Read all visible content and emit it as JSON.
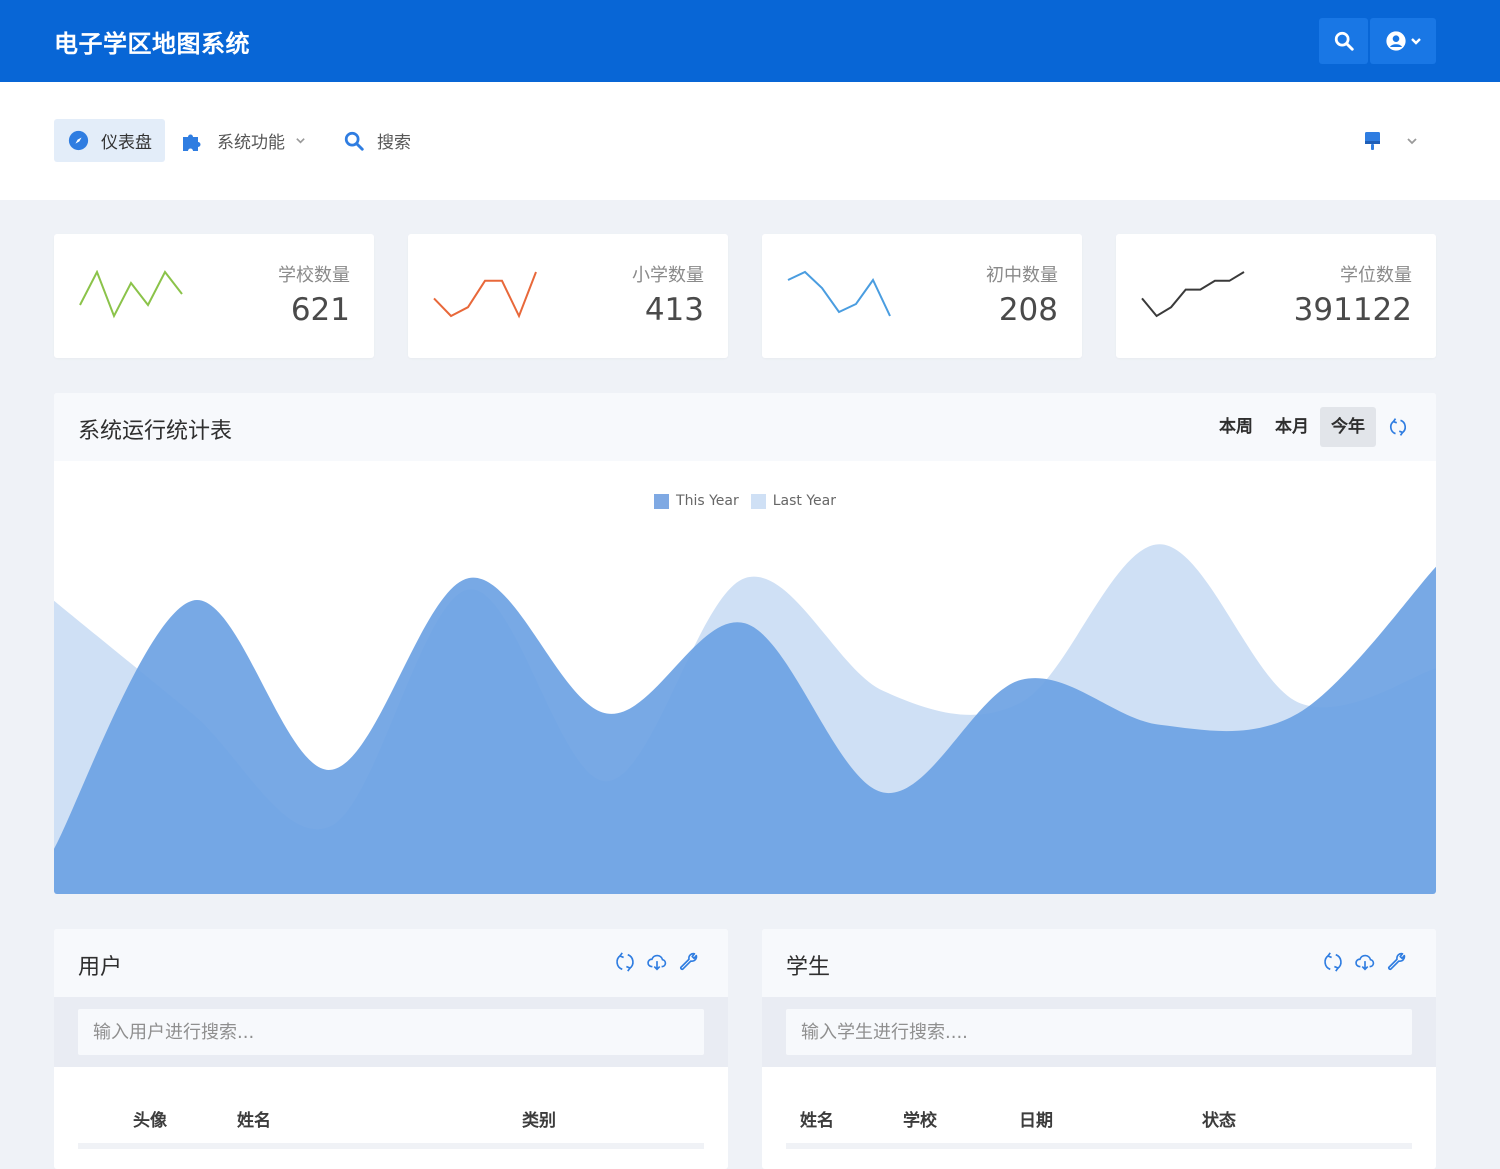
{
  "app": {
    "title": "电子学区地图系统"
  },
  "nav": {
    "dashboard": "仪表盘",
    "functions": "系统功能",
    "search": "搜索"
  },
  "stats": [
    {
      "label": "学校数量",
      "value": "621",
      "color": "#8bc34a",
      "trend": [
        3,
        6,
        2,
        5,
        3,
        6,
        4
      ]
    },
    {
      "label": "小学数量",
      "value": "413",
      "color": "#e8683a",
      "trend": [
        3,
        1,
        2,
        5,
        5,
        1,
        6
      ]
    },
    {
      "label": "初中数量",
      "value": "208",
      "color": "#4a9de0",
      "trend": [
        5,
        6,
        4,
        1,
        2,
        5,
        0.5
      ]
    },
    {
      "label": "学位数量",
      "value": "391122",
      "color": "#3a3a3a",
      "trend": [
        2,
        0,
        1,
        3,
        3,
        4,
        4,
        5
      ]
    }
  ],
  "main_chart": {
    "title": "系统运行统计表",
    "ranges": [
      "本周",
      "本月",
      "今年"
    ],
    "active_range": "今年",
    "legend": [
      {
        "name": "This Year",
        "color": "#7fa9e3"
      },
      {
        "name": "Last Year",
        "color": "#cfe0f5"
      }
    ]
  },
  "chart_data": {
    "type": "area",
    "title": "",
    "xlabel": "",
    "ylabel": "",
    "legend_position": "top-center",
    "series": [
      {
        "name": "Last Year",
        "values": [
          2.6,
          1.6,
          0.6,
          2.7,
          1.0,
          2.8,
          1.8,
          1.7,
          3.1,
          1.7,
          2.0
        ]
      },
      {
        "name": "This Year",
        "values": [
          0.4,
          2.6,
          1.1,
          2.8,
          1.6,
          2.4,
          0.9,
          1.9,
          1.5,
          1.6,
          2.9
        ]
      }
    ],
    "ylim": [
      0,
      3.2
    ]
  },
  "users_panel": {
    "title": "用户",
    "search_placeholder": "输入用户进行搜索...",
    "columns": [
      "头像",
      "姓名",
      "类别"
    ]
  },
  "students_panel": {
    "title": "学生",
    "search_placeholder": "输入学生进行搜索....",
    "columns": [
      "姓名",
      "学校",
      "日期",
      "状态"
    ]
  }
}
